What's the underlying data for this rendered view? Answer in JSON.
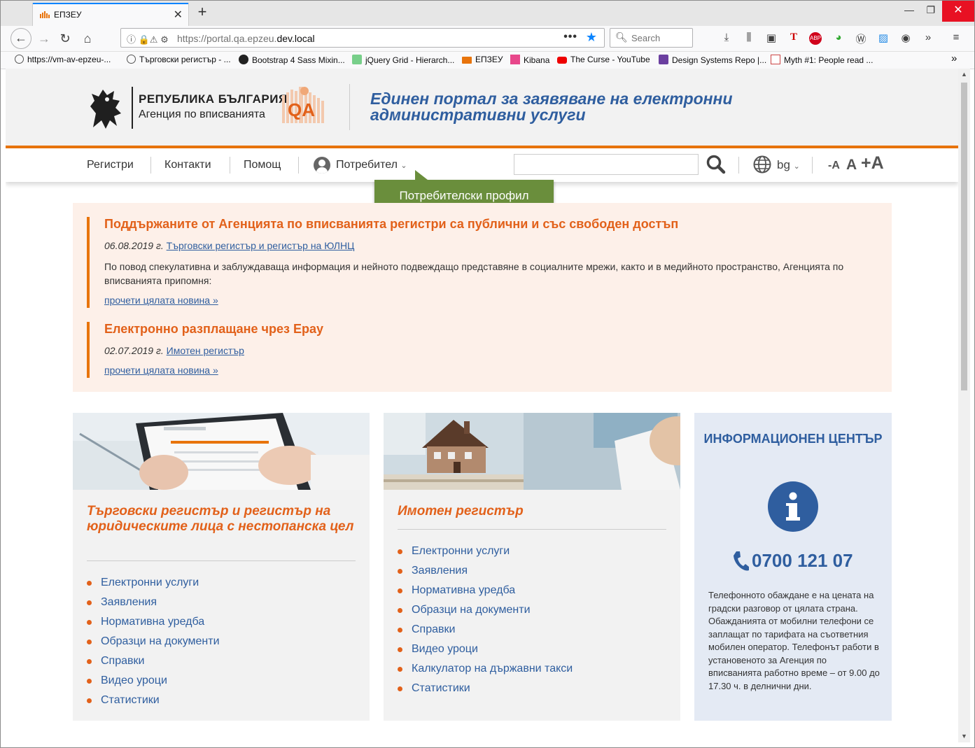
{
  "browser": {
    "tab_title": "ЕПЗЕУ",
    "url_prefix": "https://portal.qa.epzeu.",
    "url_domain": "dev.local",
    "search_placeholder": "Search",
    "bookmarks": [
      {
        "label": "https://vm-av-epzeu-...",
        "icon": "globe-icon"
      },
      {
        "label": "Търговски регистър - ...",
        "icon": "globe-icon"
      },
      {
        "label": "Bootstrap 4 Sass Mixin...",
        "icon": "github-icon"
      },
      {
        "label": "jQuery Grid - Hierarch...",
        "icon": "jquery-icon"
      },
      {
        "label": "ЕПЗЕУ",
        "icon": "epzeu-icon"
      },
      {
        "label": "Kibana",
        "icon": "kibana-icon"
      },
      {
        "label": "The Curse - YouTube",
        "icon": "youtube-icon"
      },
      {
        "label": "Design Systems Repo |...",
        "icon": "cube-icon"
      },
      {
        "label": "Myth #1: People read ...",
        "icon": "ux-icon"
      }
    ]
  },
  "header": {
    "logo_line1": "РЕПУБЛИКА БЪЛГАРИЯ",
    "logo_line2": "Агенция по вписванията",
    "qa_badge": "QA",
    "title_line1": "Единен портал за заявяване на електронни",
    "title_line2": "административни услуги"
  },
  "nav": {
    "registers": "Регистри",
    "contacts": "Контакти",
    "help": "Помощ",
    "user": "Потребител",
    "lang": "bg",
    "font_smaller": "-A",
    "font_default": "A",
    "font_larger": "+A",
    "tooltip": "Потребителски профил"
  },
  "news": [
    {
      "title": "Поддържаните от Агенцията по вписванията регистри са публични и със свободен достъп",
      "date": "06.08.2019 г.",
      "register": "Търговски регистър и регистър на ЮЛНЦ",
      "body": "По повод спекулативна и заблуждаваща информация и нейното подвеждащо представяне в социалните мрежи, както и в медийното пространство, Агенцията по вписванията припомня:",
      "more": "прочети цялата новина »"
    },
    {
      "title": "Електронно разплащане чрез Epay",
      "date": "02.07.2019 г.",
      "register": "Имотен регистър",
      "body": "",
      "more": "прочети цялата новина »"
    }
  ],
  "cards": [
    {
      "title": "Търговски регистър и регистър на юридическите лица с нестопанска цел",
      "items": [
        "Електронни услуги",
        "Заявления",
        "Нормативна уредба",
        "Образци на документи",
        "Справки",
        "Видео уроци",
        "Статистики"
      ]
    },
    {
      "title": "Имотен регистър",
      "items": [
        "Електронни услуги",
        "Заявления",
        "Нормативна уредба",
        "Образци на документи",
        "Справки",
        "Видео уроци",
        "Калкулатор на държавни такси",
        "Статистики"
      ]
    }
  ],
  "info": {
    "title": "ИНФОРМАЦИОНЕН ЦЕНТЪР",
    "phone": "0700 121 07",
    "text": "Телефонното обаждане е на цената на градски разговор от цялата страна. Обажданията от мобилни телефони се заплащат по тарифата на съответния мобилен оператор. Телефонът работи в установеното за Агенция по вписванията работно време – от 9.00 до 17.30 ч. в делнични дни."
  },
  "colors": {
    "accent_orange": "#e8740c",
    "title_orange": "#e2611a",
    "brand_blue": "#2f5e9f",
    "tooltip_green": "#6a8e3c"
  }
}
